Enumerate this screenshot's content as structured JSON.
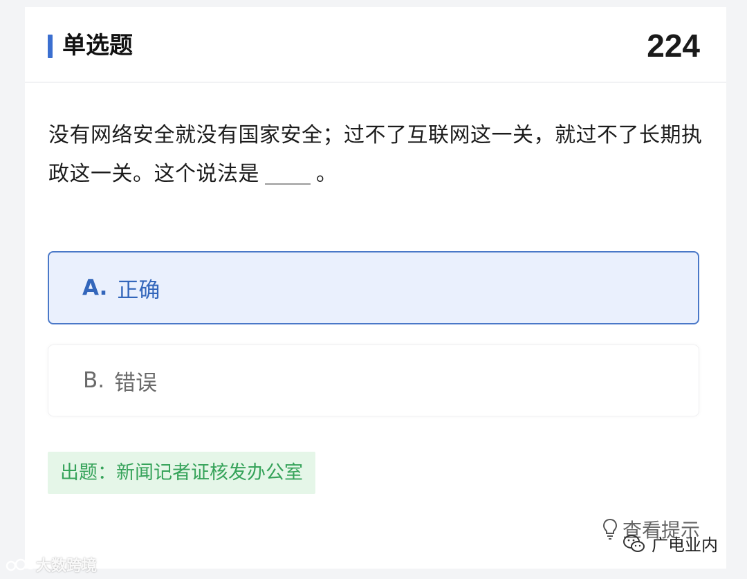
{
  "header": {
    "title": "单选题",
    "number": "224"
  },
  "question": {
    "text_before": "没有网络安全就没有国家安全；过不了互联网这一关，就过不了长期执政这一关。这个说法是",
    "text_after": "。"
  },
  "options": [
    {
      "letter": "A.",
      "text": "正确",
      "selected": true
    },
    {
      "letter": "B.",
      "text": "错误",
      "selected": false
    }
  ],
  "source": {
    "label": "出题：新闻记者证核发办公室"
  },
  "hint": {
    "label": "查看提示",
    "icon": "lightbulb-icon"
  },
  "watermarks": {
    "left": "大数跨境",
    "right": "广电业内"
  },
  "colors": {
    "accent": "#3b6fd0",
    "selected_bg": "#eaf0fd",
    "selected_border": "#4a78c8",
    "source_bg": "#e5f6e8",
    "source_text": "#36a35a"
  }
}
